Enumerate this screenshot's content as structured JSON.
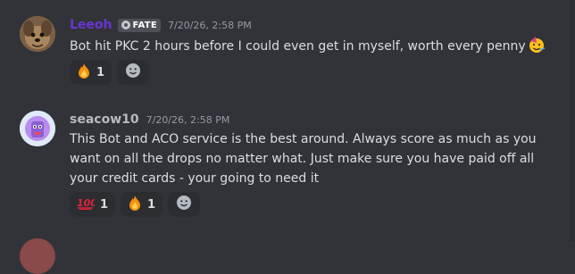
{
  "messages": [
    {
      "username": "Leeoh",
      "username_color": "#6b35d4",
      "tag_label": "FATE",
      "timestamp": "7/20/26, 2:58 PM",
      "text": "Bot hit PKC 2 hours before I could even get in myself, worth every penny",
      "trailing_emoji": "partying-face",
      "reactions": [
        {
          "emoji": "fire",
          "count": "1"
        }
      ]
    },
    {
      "username": "seacow10",
      "username_color": "#b5bac1",
      "timestamp": "7/20/26, 2:58 PM",
      "text": "This Bot and ACO service is the best around.  Always score as much as you want on all the drops no matter what.  Just make sure you have paid off all your credit cards - your going to need it",
      "reactions": [
        {
          "emoji": "hundred-points",
          "count": "1"
        },
        {
          "emoji": "fire",
          "count": "1"
        }
      ]
    }
  ],
  "colors": {
    "background": "#313338",
    "reaction_bg": "#2b2d31",
    "text": "#dbdee1",
    "muted": "#949ba4"
  }
}
